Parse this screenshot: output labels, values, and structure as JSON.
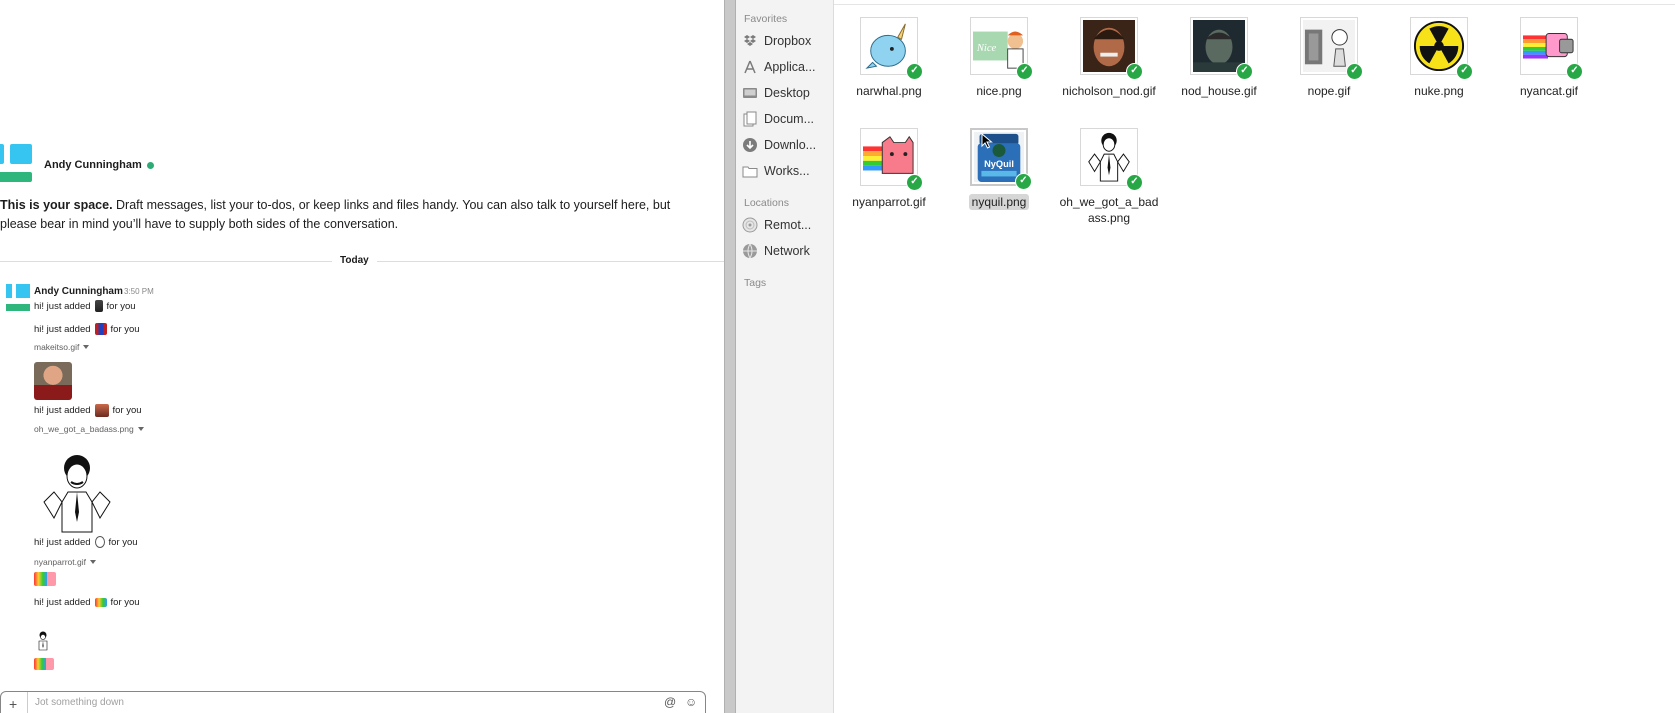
{
  "slack": {
    "intro": {
      "user_name": "Andy Cunningham",
      "bold_text": "This is your space.",
      "body_text": " Draft messages, list your to-dos, or keep links and files handy. You can also talk to yourself here, but please bear in mind you’ll have to supply both sides of the conversation."
    },
    "day_divider": "Today",
    "message": {
      "sender": "Andy Cunningham",
      "time": "3:50 PM",
      "lines": [
        {
          "prefix": "hi! just added",
          "suffix": "for you"
        },
        {
          "prefix": "hi! just added",
          "suffix": "for you"
        },
        {
          "prefix": "hi! just added",
          "suffix": "for you"
        },
        {
          "prefix": "hi! just added",
          "suffix": "for you"
        },
        {
          "prefix": "hi! just added",
          "suffix": "for you"
        }
      ],
      "files": [
        "makeitso.gif",
        "oh_we_got_a_badass.png",
        "nyanparrot.gif"
      ]
    },
    "composer": {
      "plus": "+",
      "placeholder": "Jot something down",
      "at_icon": "@",
      "emoji_icon": "☺"
    }
  },
  "finder": {
    "sidebar": {
      "favorites_heading": "Favorites",
      "favorites": [
        {
          "label": "Dropbox",
          "icon": "dropbox-icon"
        },
        {
          "label": "Applica...",
          "icon": "applications-icon"
        },
        {
          "label": "Desktop",
          "icon": "desktop-icon"
        },
        {
          "label": "Docum...",
          "icon": "documents-icon"
        },
        {
          "label": "Downlo...",
          "icon": "downloads-icon"
        },
        {
          "label": "Works...",
          "icon": "folder-icon"
        }
      ],
      "locations_heading": "Locations",
      "locations": [
        {
          "label": "Remot...",
          "icon": "remote-disc-icon"
        },
        {
          "label": "Network",
          "icon": "network-icon"
        }
      ],
      "tags_heading": "Tags"
    },
    "files": [
      {
        "name": "narwhal.png",
        "art": "narwhal"
      },
      {
        "name": "nice.png",
        "art": "nice"
      },
      {
        "name": "nicholson_nod.gif",
        "art": "nicholson"
      },
      {
        "name": "nod_house.gif",
        "art": "house"
      },
      {
        "name": "nope.gif",
        "art": "nope"
      },
      {
        "name": "nuke.png",
        "art": "nuke"
      },
      {
        "name": "nyancat.gif",
        "art": "nyancat"
      },
      {
        "name": "nyanparrot.gif",
        "art": "nyanparrot"
      },
      {
        "name": "nyquil.png",
        "art": "nyquil",
        "selected": true
      },
      {
        "name": "oh_we_got_a_badass.png",
        "art": "badass"
      }
    ],
    "file_name_lines": {
      "badass_line1": "oh_we_got_a_bad",
      "badass_line2": "ass.png"
    },
    "check_glyph": "✓"
  }
}
